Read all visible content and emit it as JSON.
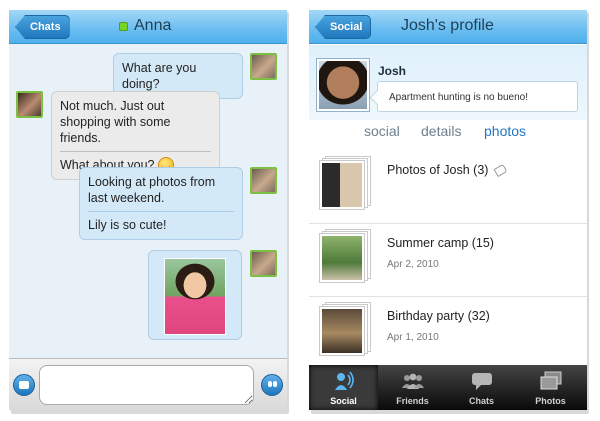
{
  "chat": {
    "back_label": "Chats",
    "contact_name": "Anna",
    "messages": {
      "m1": "What are you doing?",
      "m2a": "Not much. Just out shopping with some friends.",
      "m2b": "What about you?",
      "m3a": "Looking at photos from last weekend.",
      "m3b": "Lily is so cute!"
    },
    "input_placeholder": ""
  },
  "profile": {
    "back_label": "Social",
    "title": "Josh's profile",
    "name": "Josh",
    "status": "Apartment hunting is no bueno!",
    "segments": [
      "social",
      "details",
      "photos"
    ],
    "active_segment": "photos",
    "albums": [
      {
        "title": "Photos of Josh (3)",
        "date": ""
      },
      {
        "title": "Summer camp (15)",
        "date": "Apr 2, 2010"
      },
      {
        "title": "Birthday party (32)",
        "date": "Apr 1, 2010"
      }
    ]
  },
  "tabs": [
    {
      "label": "Social",
      "icon": "social-icon",
      "active": true
    },
    {
      "label": "Friends",
      "icon": "friends-icon",
      "active": false
    },
    {
      "label": "Chats",
      "icon": "chats-icon",
      "active": false
    },
    {
      "label": "Photos",
      "icon": "photos-icon",
      "active": false
    }
  ],
  "colors": {
    "navbar": "#69bdf0",
    "online": "#77d326",
    "active_segment": "#2176bf"
  }
}
